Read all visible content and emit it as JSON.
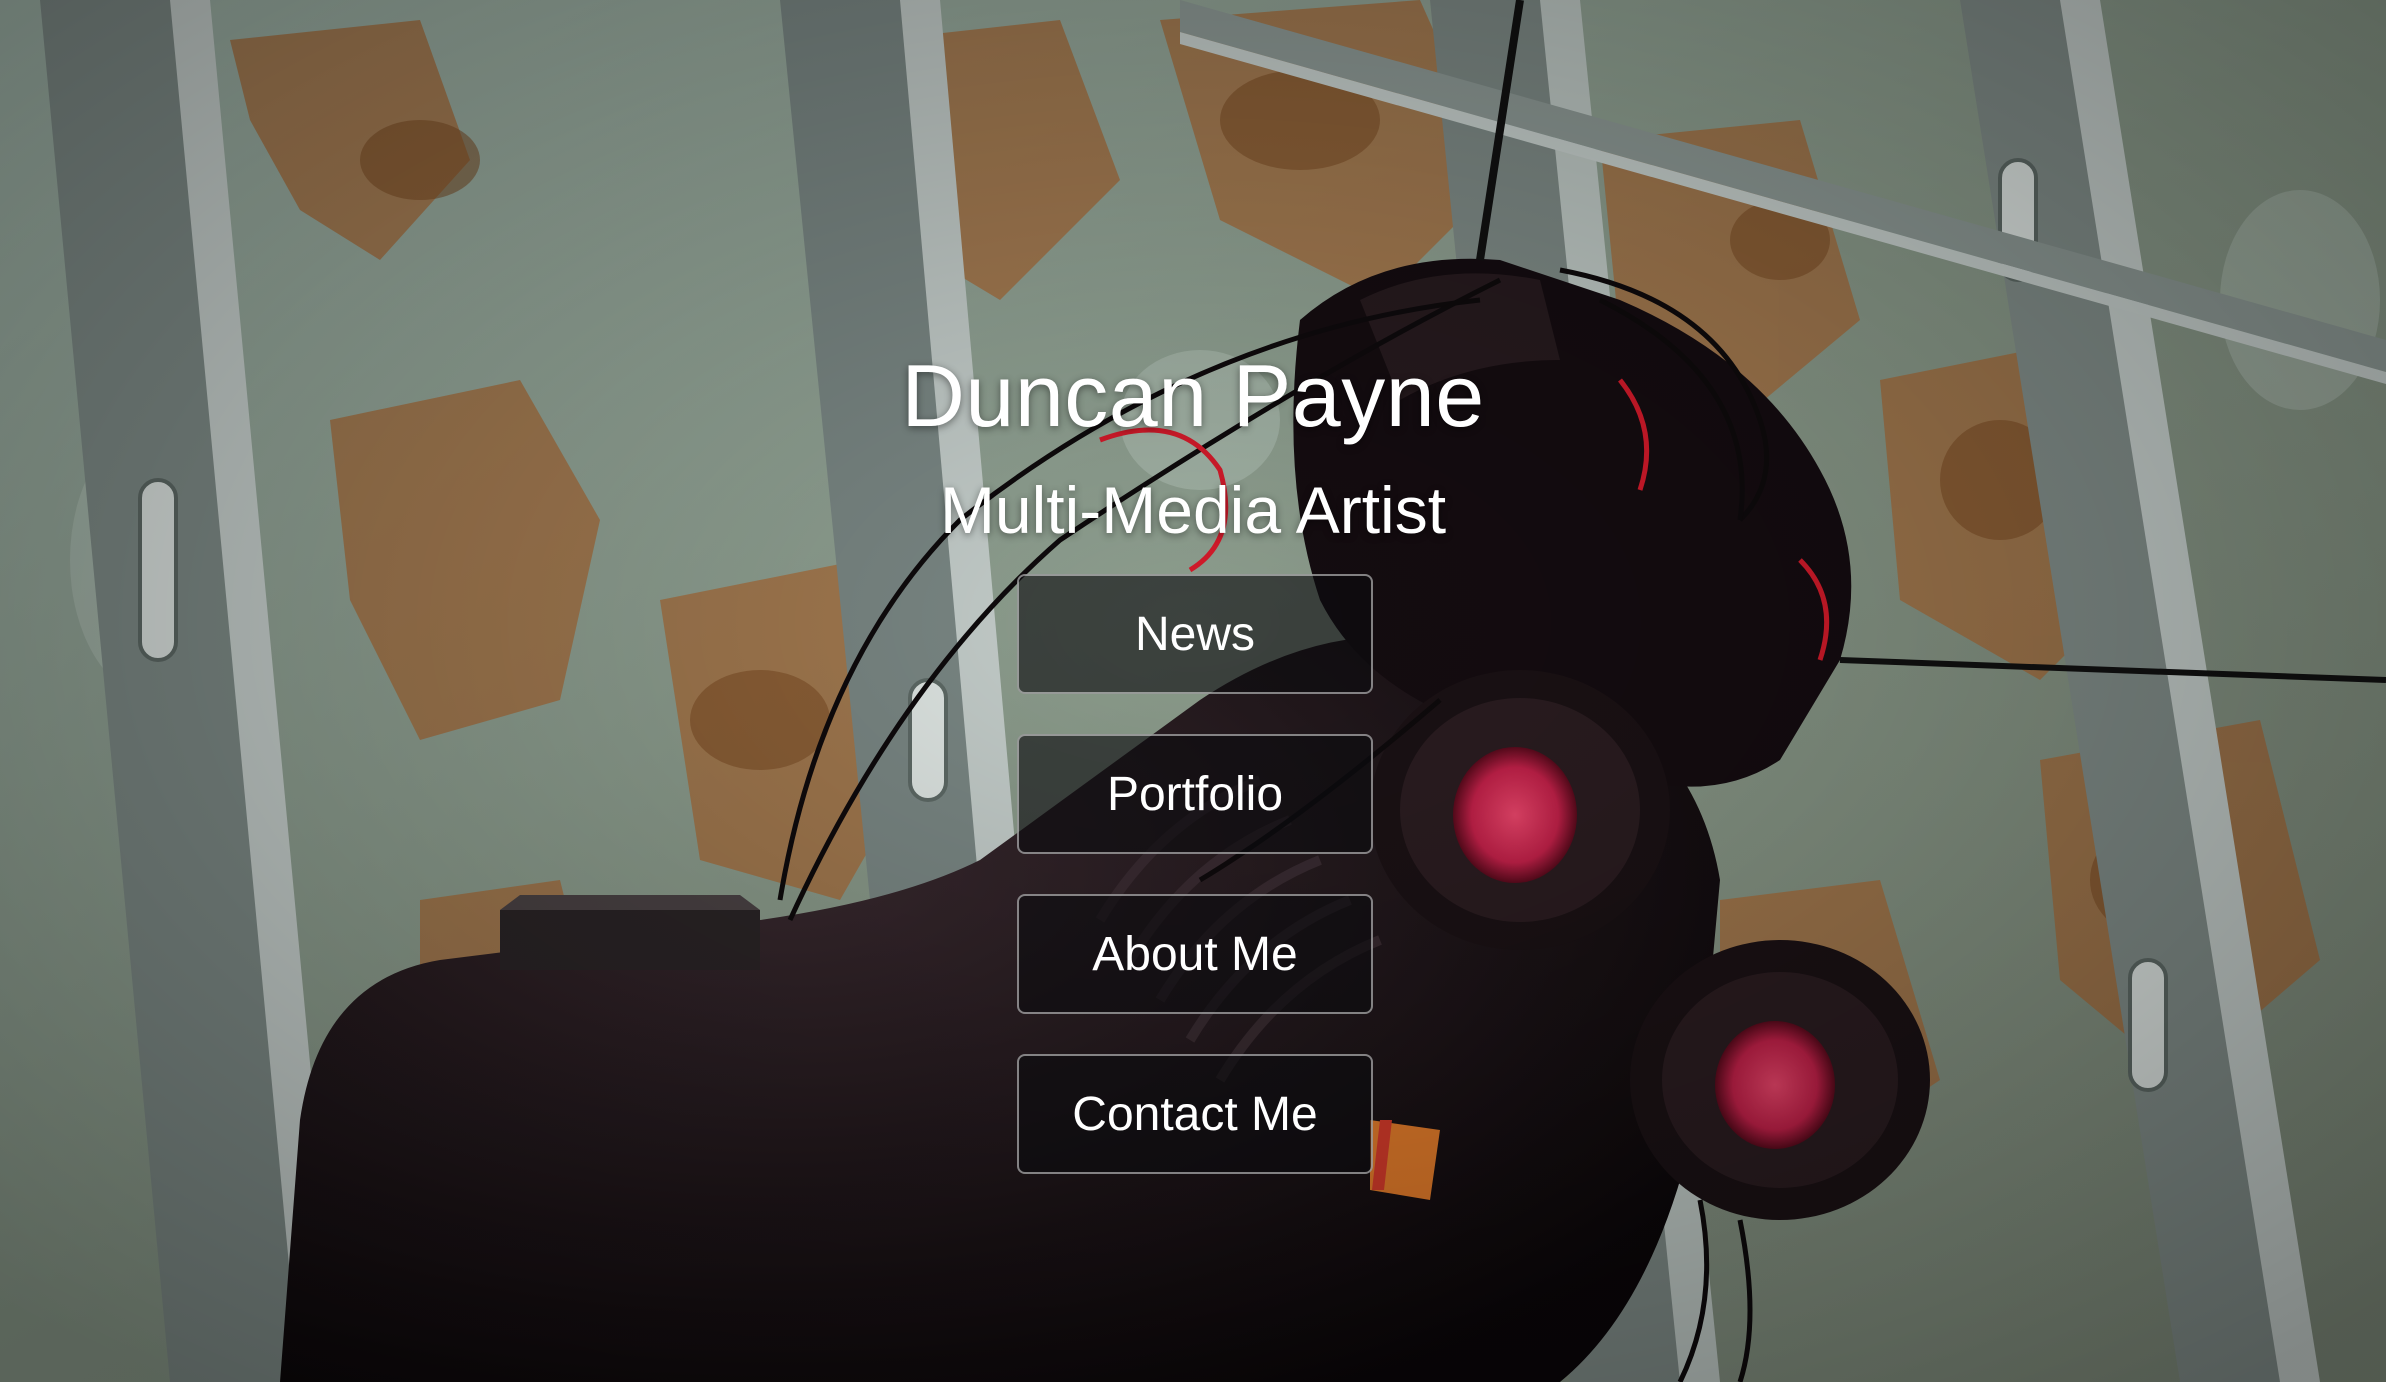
{
  "header": {
    "name": "Duncan Payne",
    "role": "Multi-Media Artist"
  },
  "nav": {
    "items": [
      {
        "label": "News"
      },
      {
        "label": "Portfolio"
      },
      {
        "label": "About Me"
      },
      {
        "label": "Contact Me"
      }
    ]
  },
  "colors": {
    "text": "#ffffff",
    "button_bg": "#0c0c0e",
    "button_border": "#e1e1e1"
  }
}
